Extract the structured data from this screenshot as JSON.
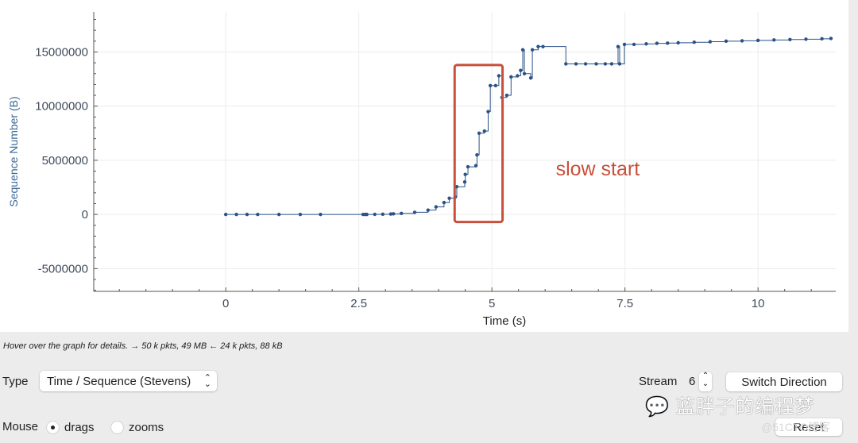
{
  "chart_data": {
    "type": "scatter",
    "title": "",
    "xlabel": "Time (s)",
    "ylabel": "Sequence Number (B)",
    "xlim": [
      -2.48,
      11.46
    ],
    "ylim": [
      -7100000,
      18700000
    ],
    "x_ticks": [
      0,
      2.5,
      5,
      7.5,
      10
    ],
    "x_tick_labels": [
      "0",
      "2.5",
      "5",
      "7.5",
      "10"
    ],
    "y_ticks": [
      -5000000,
      0,
      5000000,
      10000000,
      15000000
    ],
    "y_tick_labels": [
      "-5000000",
      "0",
      "5000000",
      "10000000",
      "15000000"
    ],
    "grid": true,
    "line_style": "step",
    "series_color": "#2b5286",
    "points": [
      [
        0,
        0
      ],
      [
        0.2,
        0
      ],
      [
        0.4,
        0
      ],
      [
        0.6,
        0
      ],
      [
        1.0,
        0
      ],
      [
        1.4,
        0
      ],
      [
        1.78,
        0
      ],
      [
        2.58,
        0
      ],
      [
        2.62,
        0
      ],
      [
        2.65,
        0
      ],
      [
        2.8,
        10000
      ],
      [
        2.95,
        20000
      ],
      [
        3.1,
        40000
      ],
      [
        3.15,
        60000
      ],
      [
        3.3,
        100000
      ],
      [
        3.55,
        200000
      ],
      [
        3.8,
        400000
      ],
      [
        3.95,
        700000
      ],
      [
        4.1,
        1100000
      ],
      [
        4.2,
        1500000
      ],
      [
        4.31,
        1600000
      ],
      [
        4.34,
        2560000
      ],
      [
        4.49,
        3000000
      ],
      [
        4.5,
        3700000
      ],
      [
        4.55,
        4400000
      ],
      [
        4.7,
        4500000
      ],
      [
        4.72,
        5500000
      ],
      [
        4.76,
        7500000
      ],
      [
        4.86,
        7700000
      ],
      [
        4.93,
        9500000
      ],
      [
        4.97,
        11900000
      ],
      [
        5.07,
        11900000
      ],
      [
        5.13,
        12800000
      ],
      [
        5.19,
        10800000
      ],
      [
        5.28,
        11000000
      ],
      [
        5.36,
        12700000
      ],
      [
        5.48,
        12800000
      ],
      [
        5.54,
        13300000
      ],
      [
        5.58,
        15200000
      ],
      [
        5.61,
        13000000
      ],
      [
        5.73,
        12600000
      ],
      [
        5.76,
        15200000
      ],
      [
        5.87,
        15500000
      ],
      [
        5.96,
        15500000
      ],
      [
        6.39,
        13900000
      ],
      [
        6.58,
        13900000
      ],
      [
        6.76,
        13900000
      ],
      [
        6.96,
        13900000
      ],
      [
        7.13,
        13900000
      ],
      [
        7.25,
        13900000
      ],
      [
        7.37,
        15500000
      ],
      [
        7.4,
        13900000
      ],
      [
        7.49,
        15700000
      ],
      [
        7.67,
        15700000
      ],
      [
        7.9,
        15750000
      ],
      [
        8.1,
        15800000
      ],
      [
        8.3,
        15820000
      ],
      [
        8.5,
        15850000
      ],
      [
        8.8,
        15900000
      ],
      [
        9.1,
        15950000
      ],
      [
        9.4,
        16000000
      ],
      [
        9.7,
        16030000
      ],
      [
        10.0,
        16070000
      ],
      [
        10.3,
        16110000
      ],
      [
        10.6,
        16150000
      ],
      [
        10.9,
        16180000
      ],
      [
        11.2,
        16220000
      ],
      [
        11.37,
        16250000
      ]
    ],
    "annotations": [
      {
        "type": "rectangle",
        "x": [
          4.3,
          5.2
        ],
        "y": [
          -700000,
          13800000
        ],
        "color": "#c8503b"
      },
      {
        "type": "text",
        "text": "slow start",
        "x": 6.2,
        "y": 3600000,
        "color": "#c8503b"
      }
    ]
  },
  "status": {
    "hint": "Hover over the graph for details. → 50 k pkts, 49 MB ← 24 k pkts, 88 kB"
  },
  "controls": {
    "type_label": "Type",
    "type_value": "Time / Sequence (Stevens)",
    "stream_label": "Stream",
    "stream_value": "6",
    "switch_direction": "Switch Direction",
    "mouse_label": "Mouse",
    "mouse_options": [
      "drags",
      "zooms"
    ],
    "mouse_selected": "drags",
    "reset": "Reset"
  },
  "watermark": {
    "text": "蓝胖子的编程梦",
    "text2": "@51CTO博客"
  }
}
